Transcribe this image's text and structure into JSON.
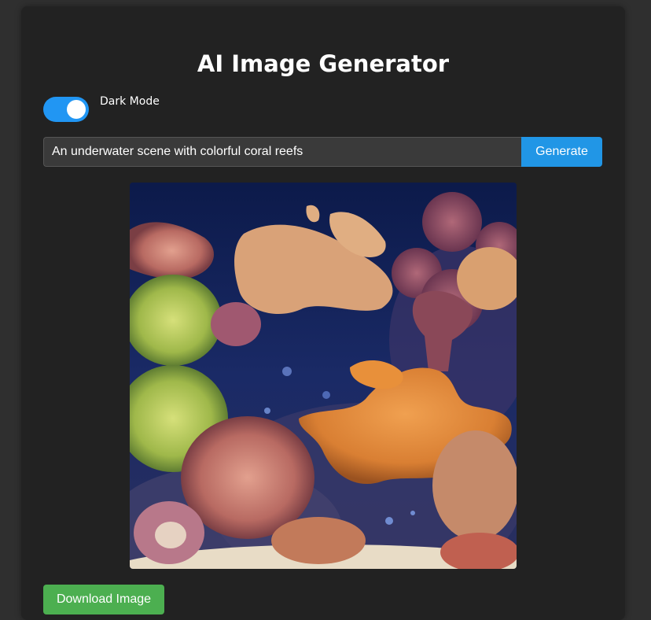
{
  "app": {
    "title": "AI Image Generator"
  },
  "theme_toggle": {
    "label": "Dark Mode",
    "checked": true,
    "color": "#2196f3"
  },
  "prompt": {
    "value": "An underwater scene with colorful coral reefs",
    "placeholder": ""
  },
  "actions": {
    "generate_label": "Generate",
    "download_label": "Download Image"
  },
  "generated_image": {
    "alt": "An underwater scene with colorful coral reefs"
  },
  "colors": {
    "page_bg": "#2f2f2f",
    "card_bg": "#222222",
    "accent_blue": "#2196e6",
    "download_green": "#4caf50"
  }
}
